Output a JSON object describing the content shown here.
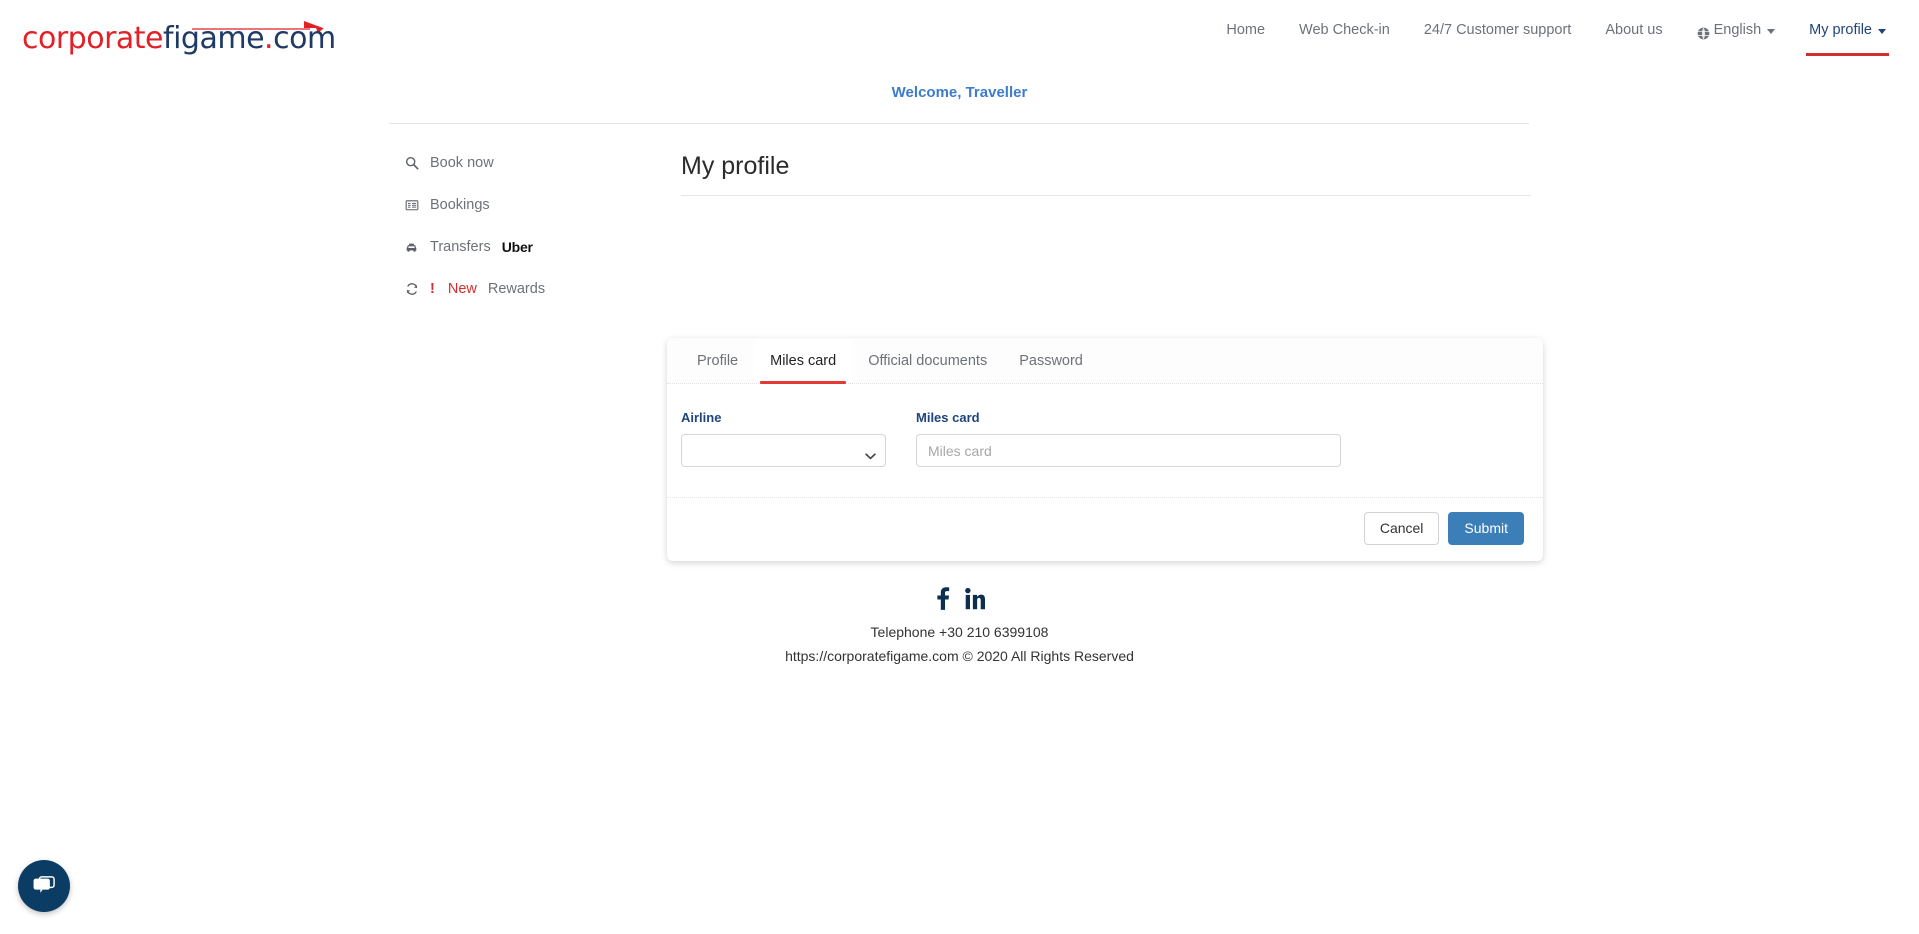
{
  "brand": {
    "logo_part_one": "corporate",
    "logo_part_two": "figame",
    "logo_dot": ".",
    "logo_part_three": "com",
    "red": "#e12127",
    "navy": "#1f3a64"
  },
  "topnav": {
    "items": [
      {
        "label": "Home",
        "active": false
      },
      {
        "label": "Web Check-in",
        "active": false
      },
      {
        "label": "24/7 Customer support",
        "active": false
      },
      {
        "label": "About us",
        "active": false
      },
      {
        "label": "English",
        "active": false
      },
      {
        "label": "My profile",
        "active": true
      }
    ],
    "home": "Home",
    "web_checkin": "Web Check-in",
    "support": "24/7 Customer support",
    "about": "About us",
    "language": "English",
    "profile": "My profile"
  },
  "welcome": {
    "text": "Welcome, Traveller"
  },
  "sidebar": {
    "items": [
      {
        "label": "Book now",
        "icon": "search-icon"
      },
      {
        "label": "Bookings",
        "icon": "list-icon"
      },
      {
        "label": "Transfers",
        "icon": "taxi-icon",
        "brand": "Uber"
      },
      {
        "label": "Rewards",
        "icon": "refresh-icon",
        "badge": "New",
        "marker": "!"
      }
    ],
    "book_now": "Book now",
    "bookings": "Bookings",
    "transfers": "Transfers",
    "transfers_brand": "Uber",
    "rewards_marker": "!",
    "rewards_new": "New",
    "rewards": "Rewards"
  },
  "main": {
    "page_title": "My profile",
    "tabs": [
      {
        "label": "Profile",
        "active": false
      },
      {
        "label": "Miles card",
        "active": true
      },
      {
        "label": "Official documents",
        "active": false
      },
      {
        "label": "Password",
        "active": false
      }
    ],
    "tab_profile": "Profile",
    "tab_miles_card": "Miles card",
    "tab_official_documents": "Official documents",
    "tab_password": "Password"
  },
  "form": {
    "airline_label": "Airline",
    "airline_value": "",
    "airline_options": [
      ""
    ],
    "miles_card_label": "Miles card",
    "miles_card_value": "",
    "miles_card_placeholder": "Miles card",
    "cancel_label": "Cancel",
    "submit_label": "Submit",
    "submit_color": "#3c7eb8"
  },
  "footer": {
    "facebook": "f",
    "linkedin": "in",
    "telephone": "Telephone +30 210 6399108",
    "copyright": "https://corporatefigame.com © 2020 All Rights Reserved"
  },
  "chat": {
    "icon": "chat-bubble-icon",
    "color": "#0b3c63"
  }
}
